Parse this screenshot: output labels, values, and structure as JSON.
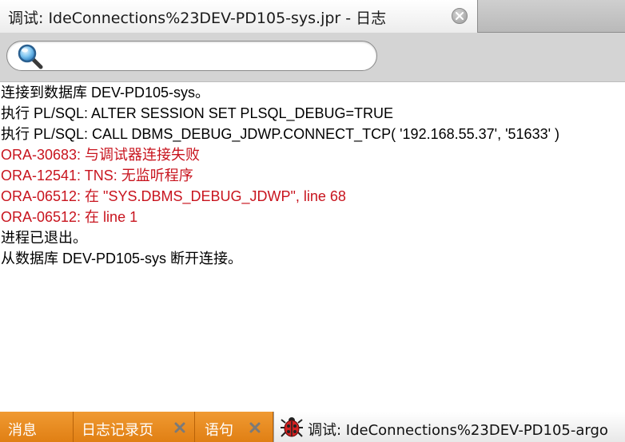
{
  "window": {
    "tab_title": "调试: IdeConnections%23DEV-PD105-sys.jpr - 日志"
  },
  "search": {
    "value": "",
    "placeholder": ""
  },
  "log": {
    "lines": [
      {
        "text": "连接到数据库 DEV-PD105-sys。",
        "type": "info"
      },
      {
        "text": "执行 PL/SQL: ALTER SESSION SET PLSQL_DEBUG=TRUE",
        "type": "info"
      },
      {
        "text": "执行 PL/SQL: CALL DBMS_DEBUG_JDWP.CONNECT_TCP( '192.168.55.37', '51633' )",
        "type": "info"
      },
      {
        "text": "ORA-30683: 与调试器连接失败",
        "type": "error"
      },
      {
        "text": "ORA-12541: TNS: 无监听程序",
        "type": "error"
      },
      {
        "text": "ORA-06512: 在 \"SYS.DBMS_DEBUG_JDWP\", line 68",
        "type": "error"
      },
      {
        "text": "ORA-06512: 在 line 1",
        "type": "error"
      },
      {
        "text": "进程已退出。",
        "type": "info"
      },
      {
        "text": "从数据库 DEV-PD105-sys 断开连接。",
        "type": "info"
      }
    ]
  },
  "bottom_tabs": [
    {
      "label": "消息",
      "closable": false,
      "active": false
    },
    {
      "label": "日志记录页",
      "closable": true,
      "active": false
    },
    {
      "label": "语句",
      "closable": true,
      "active": false
    },
    {
      "label": "调试: IdeConnections%23DEV-PD105-argo",
      "closable": false,
      "active": true,
      "icon": "bug-icon"
    }
  ],
  "colors": {
    "error": "#c8141e",
    "bottom_bar": "#e07f14"
  }
}
